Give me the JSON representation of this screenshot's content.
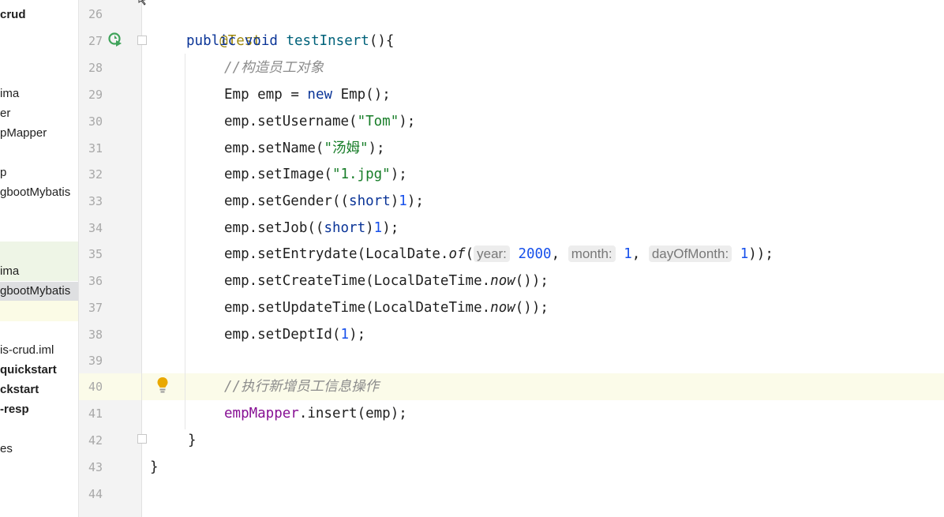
{
  "sidebar": {
    "items": [
      {
        "label": "crud",
        "bold": true,
        "hl": ""
      },
      {
        "label": "ima",
        "bold": false,
        "hl": ""
      },
      {
        "label": "er",
        "bold": false,
        "hl": ""
      },
      {
        "label": "pMapper",
        "bold": false,
        "hl": ""
      },
      {
        "label": "p",
        "bold": false,
        "hl": ""
      },
      {
        "label": "gbootMybatis",
        "bold": false,
        "hl": ""
      },
      {
        "label": "ima",
        "bold": false,
        "hl": "green"
      },
      {
        "label": "gbootMybatis",
        "bold": false,
        "hl": "sel"
      },
      {
        "label": "is-crud.iml",
        "bold": false,
        "hl": ""
      },
      {
        "label": "quickstart",
        "bold": true,
        "hl": ""
      },
      {
        "label": "ckstart",
        "bold": true,
        "hl": ""
      },
      {
        "label": "-resp",
        "bold": true,
        "hl": ""
      },
      {
        "label": "es",
        "bold": false,
        "hl": ""
      }
    ]
  },
  "editor": {
    "line_numbers": [
      "26",
      "27",
      "28",
      "29",
      "30",
      "31",
      "32",
      "33",
      "34",
      "35",
      "36",
      "37",
      "38",
      "39",
      "40",
      "41",
      "42",
      "43",
      "44"
    ],
    "current_line": "40",
    "lines": {
      "l26": {
        "annotation": "@Test"
      },
      "l27": {
        "kw1": "public",
        "kw2": "void",
        "name": "testInsert",
        "rest": "(){"
      },
      "l28": {
        "comment": "//构造员工对象"
      },
      "l29": {
        "type": "Emp",
        "var": "emp",
        "eq": "=",
        "kw": "new",
        "ctor": "Emp();"
      },
      "l30": {
        "call": "emp.setUsername(",
        "str": "\"Tom\"",
        "end": ");"
      },
      "l31": {
        "call": "emp.setName(",
        "str": "\"汤姆\"",
        "end": ");"
      },
      "l32": {
        "call": "emp.setImage(",
        "str": "\"1.jpg\"",
        "end": ");"
      },
      "l33": {
        "call": "emp.setGender((",
        "kw": "short",
        "close": ")",
        "num": "1",
        "end": ");"
      },
      "l34": {
        "call": "emp.setJob((",
        "kw": "short",
        "close": ")",
        "num": "1",
        "end": ");"
      },
      "l35": {
        "call": "emp.setEntrydate(LocalDate.",
        "method": "of",
        "open": "(",
        "hint1": "year:",
        "num1": "2000",
        "hint2": "month:",
        "num2": "1",
        "hint3": "dayOfMonth:",
        "num3": "1",
        "end": "));"
      },
      "l36": {
        "call": "emp.setCreateTime(LocalDateTime.",
        "method": "now",
        "end": "());"
      },
      "l37": {
        "call": "emp.setUpdateTime(LocalDateTime.",
        "method": "now",
        "end": "());"
      },
      "l38": {
        "call": "emp.setDeptId(",
        "num": "1",
        "end": ");"
      },
      "l40": {
        "comment": "//执行新增员工信息操作"
      },
      "l41": {
        "field": "empMapper",
        "call": ".insert(emp);"
      },
      "l42": {
        "brace": "}"
      },
      "l43": {
        "brace": "}"
      }
    }
  },
  "colors": {
    "annotation": "#9e880d",
    "keyword": "#0a3497",
    "string": "#177d28",
    "number": "#1750eb",
    "comment": "#8c8c8c",
    "field": "#871094",
    "current_line_bg": "#fbfbe9",
    "bulb": "#e9a800",
    "run": "#3fa35a"
  },
  "icons": {
    "run": "run-test-icon",
    "bulb": "intention-bulb-icon"
  }
}
